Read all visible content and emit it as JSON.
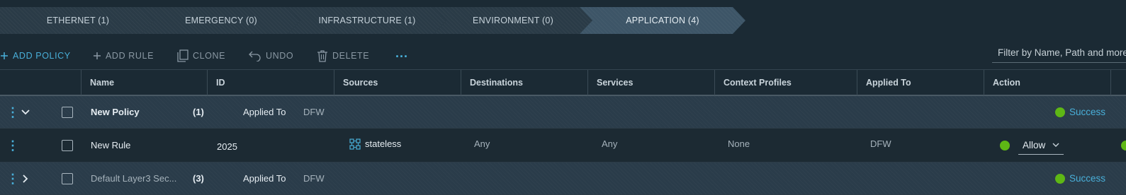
{
  "tabs": [
    {
      "label": "ETHERNET (1)"
    },
    {
      "label": "EMERGENCY (0)"
    },
    {
      "label": "INFRASTRUCTURE (1)"
    },
    {
      "label": "ENVIRONMENT (0)"
    },
    {
      "label": "APPLICATION (4)",
      "active": true
    }
  ],
  "toolbar": {
    "add_policy": "ADD POLICY",
    "add_rule": "ADD RULE",
    "clone": "CLONE",
    "undo": "UNDO",
    "delete": "DELETE",
    "more": "...",
    "filter_placeholder": "Filter by Name, Path and more"
  },
  "columns": [
    "Name",
    "ID",
    "Sources",
    "Destinations",
    "Services",
    "Context Profiles",
    "Applied To",
    "Action"
  ],
  "rows": [
    {
      "type": "policy",
      "name": "New Policy",
      "count": "(1)",
      "applied_label": "Applied To",
      "applied_value": "DFW",
      "status": "Success",
      "expanded": true
    },
    {
      "type": "rule",
      "name": "New Rule",
      "id": "2025",
      "source": "stateless",
      "destination": "Any",
      "service": "Any",
      "context": "None",
      "applied": "DFW",
      "action": "Allow"
    },
    {
      "type": "policy",
      "name": "Default Layer3 Sec...",
      "count": "(3)",
      "applied_label": "Applied To",
      "applied_value": "DFW",
      "status": "Success",
      "expanded": false
    }
  ],
  "colors": {
    "accent": "#49afd9",
    "success": "#5eb715",
    "bg": "#1b2a34"
  }
}
